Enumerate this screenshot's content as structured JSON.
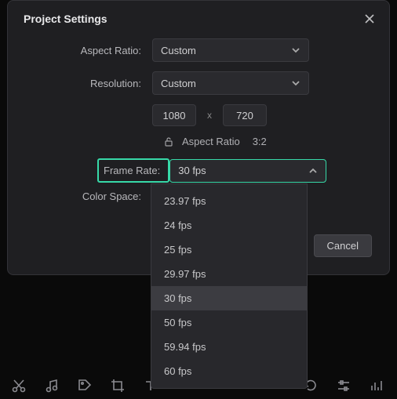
{
  "dialog": {
    "title": "Project Settings",
    "labels": {
      "aspect_ratio": "Aspect Ratio:",
      "resolution": "Resolution:",
      "frame_rate": "Frame Rate:",
      "color_space": "Color Space:"
    },
    "aspect_ratio": {
      "selected": "Custom"
    },
    "resolution": {
      "selected": "Custom",
      "width": "1080",
      "x": "x",
      "height": "720",
      "lock_label": "Aspect Ratio",
      "lock_ratio": "3:2"
    },
    "frame_rate": {
      "selected": "30 fps",
      "options": [
        "23.97 fps",
        "24 fps",
        "25 fps",
        "29.97 fps",
        "30 fps",
        "50 fps",
        "59.94 fps",
        "60 fps"
      ]
    },
    "buttons": {
      "cancel": "Cancel"
    }
  }
}
